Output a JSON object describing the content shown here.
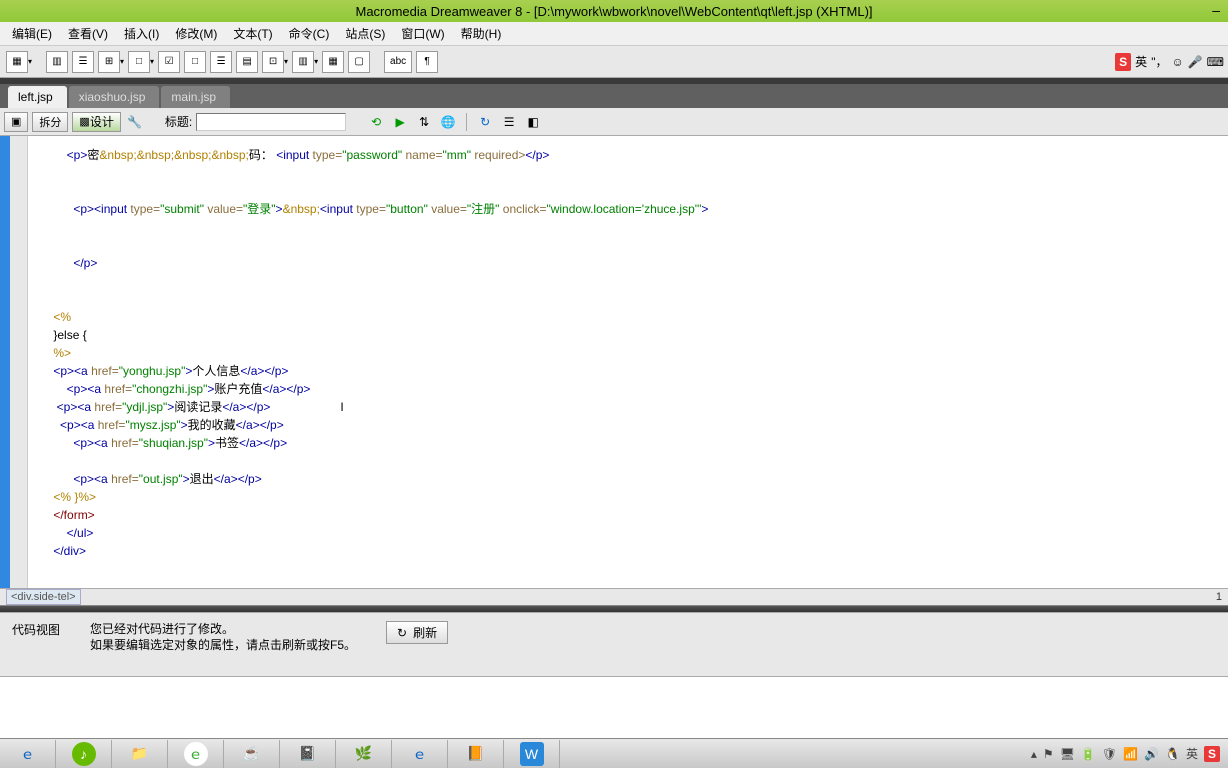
{
  "window": {
    "title": "Macromedia Dreamweaver 8 - [D:\\mywork\\wbwork\\novel\\WebContent\\qt\\left.jsp (XHTML)]"
  },
  "menus": {
    "edit": "编辑(E)",
    "view": "查看(V)",
    "insert": "插入(I)",
    "modify": "修改(M)",
    "text": "文本(T)",
    "commands": "命令(C)",
    "site": "站点(S)",
    "window": "窗口(W)",
    "help": "帮助(H)"
  },
  "insertbar_icons": [
    "▦",
    "▥",
    "☰",
    "⊞",
    "□",
    "☑",
    "□",
    "☰",
    "▤",
    "⊡",
    "▥",
    "▦",
    "▢",
    "abc",
    "¶"
  ],
  "ime": {
    "sogou": "S",
    "lang": "英"
  },
  "tabs": {
    "active": "left.jsp",
    "others": [
      "xiaoshuo.jsp",
      "main.jsp"
    ]
  },
  "doc_toolbar": {
    "split": "拆分",
    "design": "设计",
    "title_label": "标题:",
    "title_value": ""
  },
  "code": {
    "l1a": "<p>",
    "l1b": "密",
    "l1c": "&nbsp;&nbsp;&nbsp;&nbsp;",
    "l1d": "码：",
    "l1e": "<input",
    "l1f": " type=",
    "l1g": "\"password\"",
    "l1h": " name=",
    "l1i": "\"mm\"",
    "l1j": " required>",
    "l1k": "</p>",
    "l2a": "<p>",
    "l2b": "<input",
    "l2c": " type=",
    "l2d": "\"submit\"",
    "l2e": " value=",
    "l2f": "\"登录\"",
    "l2g": ">",
    "l2h": "&nbsp;",
    "l2i": "<input",
    "l2j": " type=",
    "l2k": "\"button\"",
    "l2l": " value=",
    "l2m": "\"注册\"",
    "l2n": " onclick=",
    "l2o": "\"window.location='zhuce.jsp'\"",
    "l2p": ">",
    "l3": "</p>",
    "l4": "<%",
    "l5": "}else {",
    "l6": "%>",
    "l7a": "<p>",
    "l7b": "<a",
    "l7c": " href=",
    "l7d": "\"yonghu.jsp\"",
    "l7e": ">",
    "l7f": "个人信息",
    "l7g": "</a></p>",
    "l8a": "<p>",
    "l8b": "<a",
    "l8c": " href=",
    "l8d": "\"chongzhi.jsp\"",
    "l8e": ">",
    "l8f": "账户充值",
    "l8g": "</a></p>",
    "l9a": "<p>",
    "l9b": "<a",
    "l9c": " href=",
    "l9d": "\"ydjl.jsp\"",
    "l9e": ">",
    "l9f": "阅读记录",
    "l9g": "</a></p>",
    "l10a": "<p>",
    "l10b": "<a",
    "l10c": " href=",
    "l10d": "\"mysz.jsp\"",
    "l10e": ">",
    "l10f": "我的收藏",
    "l10g": "</a></p>",
    "l11a": "<p>",
    "l11b": "<a",
    "l11c": " href=",
    "l11d": "\"shuqian.jsp\"",
    "l11e": ">",
    "l11f": "书签",
    "l11g": "</a></p>",
    "l12a": "<p>",
    "l12b": "<a",
    "l12c": " href=",
    "l12d": "\"out.jsp\"",
    "l12e": ">",
    "l12f": "退出",
    "l12g": "</a></p>",
    "l13": "<% }%>",
    "l14": "</form>",
    "l15": "</ul>",
    "l16": "</div>"
  },
  "tag_path": "<div.side-tel>",
  "line_number": "1",
  "properties": {
    "view_label": "代码视图",
    "msg1": "您已经对代码进行了修改。",
    "msg2": "如果要编辑选定对象的属性，请点击刷新或按F5。",
    "refresh": "刷新"
  },
  "tray": {
    "lang": "英",
    "sogou": "S"
  }
}
